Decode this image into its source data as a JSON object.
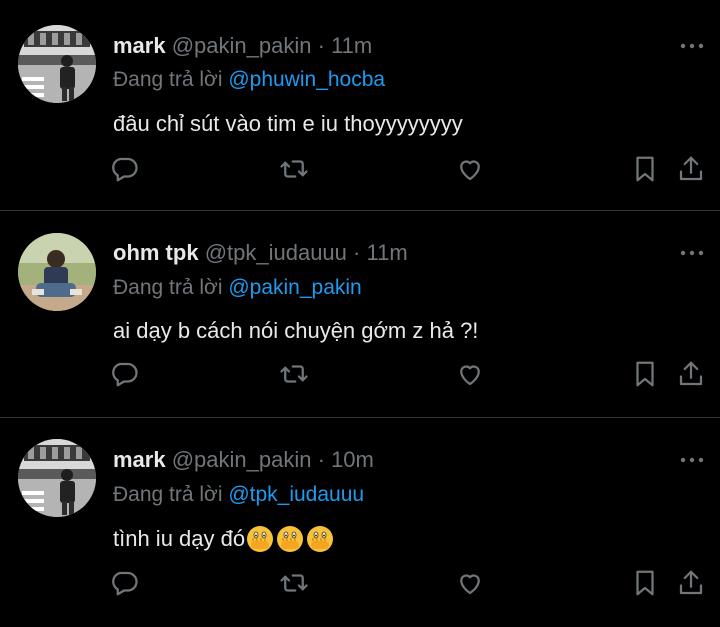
{
  "colors": {
    "background": "#000000",
    "primary_text": "#e7e9ea",
    "secondary_text": "#71767b",
    "mention": "#1d9bf0",
    "divider": "#2f3336"
  },
  "reply_prefix": "Đang trả lời",
  "tweets": [
    {
      "display_name": "mark",
      "handle": "@pakin_pakin",
      "separator": "·",
      "time": "11m",
      "reply_to": "@phuwin_hocba",
      "text": "đâu chỉ sút vào tim e iu thoyyyyyyyy",
      "avatar": "grayscale-street-photo-avatar"
    },
    {
      "display_name": "ohm tpk",
      "handle": "@tpk_iudauuu",
      "separator": "·",
      "time": "11m",
      "reply_to": "@pakin_pakin",
      "text": "ai dạy b cách nói chuyện gớm z hả ?!",
      "avatar": "outdoor-photo-avatar"
    },
    {
      "display_name": "mark",
      "handle": "@pakin_pakin",
      "separator": "·",
      "time": "10m",
      "reply_to": "@tpk_iudauuu",
      "text": "tình iu dạy đó",
      "emojis": [
        "face-with-open-eyes-and-hand-over-mouth",
        "face-with-open-eyes-and-hand-over-mouth",
        "face-with-open-eyes-and-hand-over-mouth"
      ],
      "avatar": "grayscale-street-photo-avatar"
    }
  ],
  "action_icons": [
    "reply-icon",
    "retweet-icon",
    "like-icon",
    "bookmark-icon",
    "share-icon"
  ]
}
